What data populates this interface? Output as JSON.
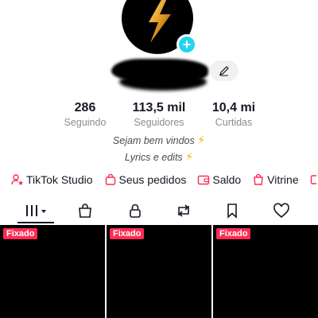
{
  "profile": {
    "add_icon": "+"
  },
  "stats": [
    {
      "value": "286",
      "label": "Seguindo"
    },
    {
      "value": "113,5 mil",
      "label": "Seguidores"
    },
    {
      "value": "10,4 mi",
      "label": "Curtidas"
    }
  ],
  "bio": {
    "line1": "Sejam bem vindos",
    "line2": "Lyrics e edits",
    "emoji": "⚡"
  },
  "quick_links": [
    {
      "label": "TikTok Studio",
      "icon": "person-star-icon"
    },
    {
      "label": "Seus pedidos",
      "icon": "bag-icon"
    },
    {
      "label": "Saldo",
      "icon": "wallet-icon"
    },
    {
      "label": "Vitrine",
      "icon": "shop-bag-icon"
    }
  ],
  "tabs": [
    "videos-grid-icon",
    "bag-icon",
    "lock-icon",
    "repost-icon",
    "bookmark-icon",
    "heart-icon"
  ],
  "videos": [
    {
      "badge": "Fixado"
    },
    {
      "badge": "Fixado"
    },
    {
      "badge": "Fixado"
    }
  ],
  "colors": {
    "accent": "#fe2c55",
    "add_button": "#20d5ec",
    "bolt": "#f5b400"
  }
}
